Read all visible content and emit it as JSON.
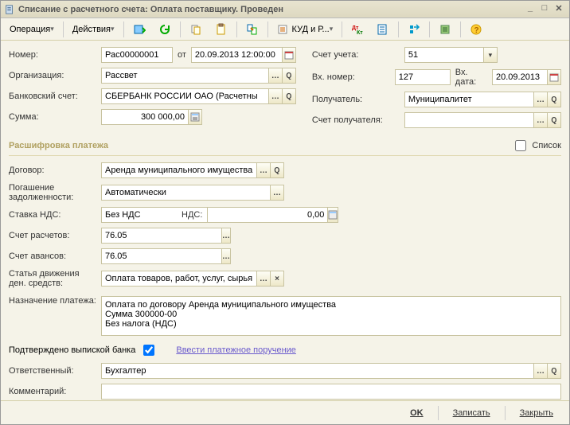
{
  "title": "Списание с расчетного счета: Оплата поставщику. Проведен",
  "toolbar": {
    "operation": "Операция",
    "actions": "Действия",
    "kudir": "КУД и Р..."
  },
  "labels": {
    "number": "Номер:",
    "from": "от",
    "account": "Счет учета:",
    "org": "Организация:",
    "incoming_no": "Вх. номер:",
    "incoming_date": "Вх. дата:",
    "bank_account": "Банковский счет:",
    "recipient": "Получатель:",
    "sum": "Сумма:",
    "recipient_account": "Счет получателя:",
    "section_payment": "Расшифровка платежа",
    "list": "Список",
    "contract": "Договор:",
    "debt_repay": "Погашение задолженности:",
    "vat_rate": "Ставка НДС:",
    "vat": "НДС:",
    "calc_account": "Счет расчетов:",
    "advance_account": "Счет авансов:",
    "cashflow_item": "Статья движения ден. средств:",
    "purpose": "Назначение платежа:",
    "bank_confirmed": "Подтверждено выпиской банка",
    "enter_payment_order": "Ввести платежное поручение",
    "responsible": "Ответственный:",
    "comment": "Комментарий:"
  },
  "values": {
    "number": "Рас00000001",
    "date": "20.09.2013 12:00:00",
    "account": "51",
    "org": "Рассвет",
    "incoming_no": "127",
    "incoming_date": "20.09.2013",
    "bank_account": "СБЕРБАНК РОССИИ ОАО (Расчетны",
    "recipient": "Муниципалитет",
    "sum": "300 000,00",
    "recipient_account": "",
    "contract": "Аренда муниципального имущества",
    "debt_repay": "Автоматически",
    "vat_rate": "Без НДС",
    "vat": "0,00",
    "calc_account": "76.05",
    "advance_account": "76.05",
    "cashflow_item": "Оплата товаров, работ, услуг, сырья",
    "purpose": "Оплата по договору Аренда муниципального имущества\nСумма 300000-00\nБез налога (НДС)",
    "responsible": "Бухгалтер",
    "comment": ""
  },
  "footer": {
    "ok": "OK",
    "save": "Записать",
    "close": "Закрыть"
  }
}
